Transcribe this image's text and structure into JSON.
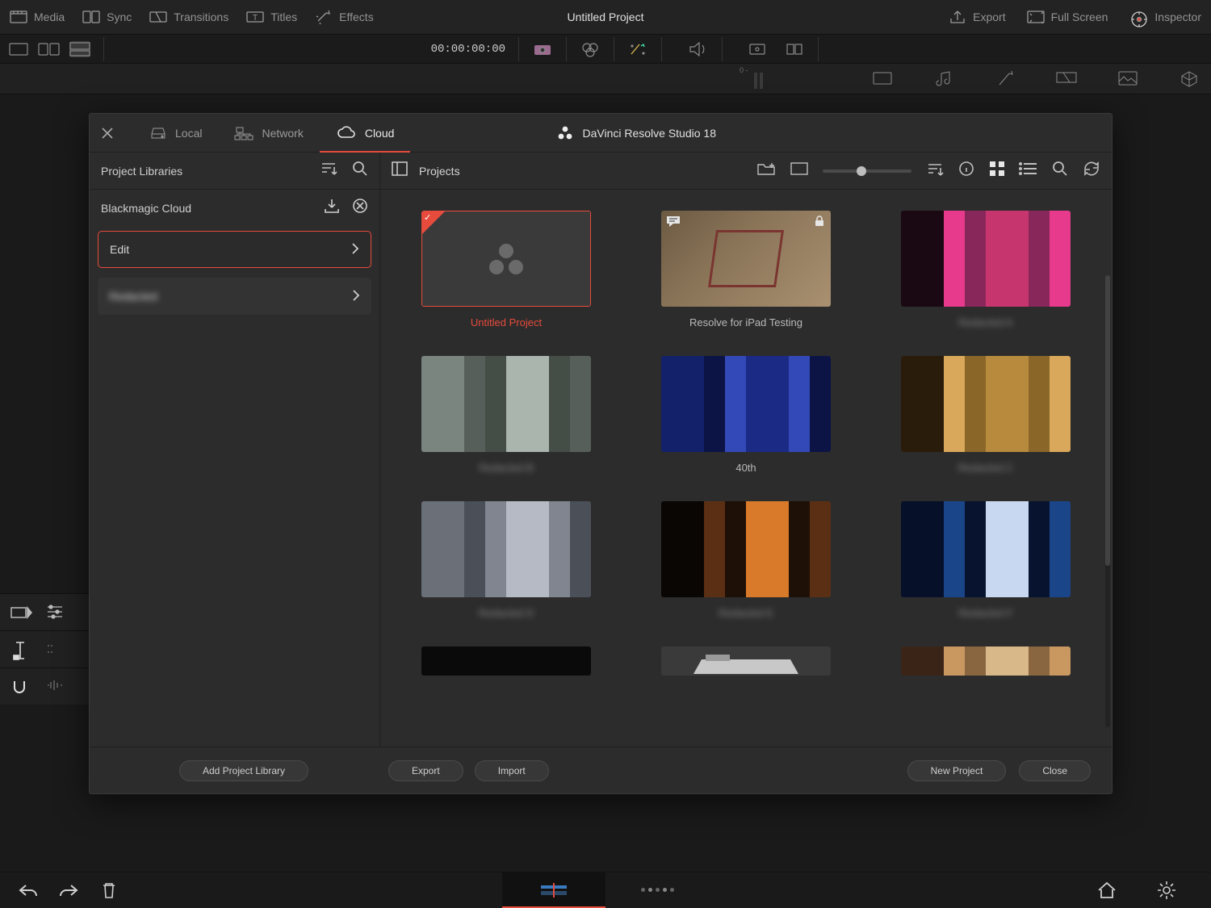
{
  "topbar": {
    "media": "Media",
    "sync": "Sync",
    "transitions": "Transitions",
    "titles": "Titles",
    "effects": "Effects",
    "project_title": "Untitled Project",
    "export": "Export",
    "full_screen": "Full Screen",
    "inspector": "Inspector"
  },
  "secbar": {
    "timecode": "00:00:00:00"
  },
  "audio": {
    "peak_label": "0 -"
  },
  "dialog": {
    "tabs": {
      "local": "Local",
      "network": "Network",
      "cloud": "Cloud"
    },
    "brand": "DaVinci Resolve Studio 18",
    "sidebar": {
      "title": "Project Libraries",
      "cloud_lib": "Blackmagic Cloud",
      "items": [
        {
          "label": "Edit",
          "selected": true
        },
        {
          "label": "Redacted",
          "blurred": true
        }
      ]
    },
    "main": {
      "title": "Projects",
      "projects": [
        {
          "label": "Untitled Project",
          "selected": true,
          "checked": true,
          "placeholder": true
        },
        {
          "label": "Resolve for iPad Testing",
          "note": true,
          "lock": true
        },
        {
          "label": "Redacted A",
          "blurred": true
        },
        {
          "label": "Redacted B",
          "blurred": true
        },
        {
          "label": "40th"
        },
        {
          "label": "Redacted C",
          "blurred": true
        },
        {
          "label": "Redacted D",
          "blurred": true
        },
        {
          "label": "Redacted E",
          "blurred": true,
          "two_line": true
        },
        {
          "label": "Redacted F",
          "blurred": true,
          "two_line": true
        }
      ]
    },
    "footer": {
      "add_library": "Add Project Library",
      "export": "Export",
      "import": "Import",
      "new_project": "New Project",
      "close": "Close"
    }
  }
}
